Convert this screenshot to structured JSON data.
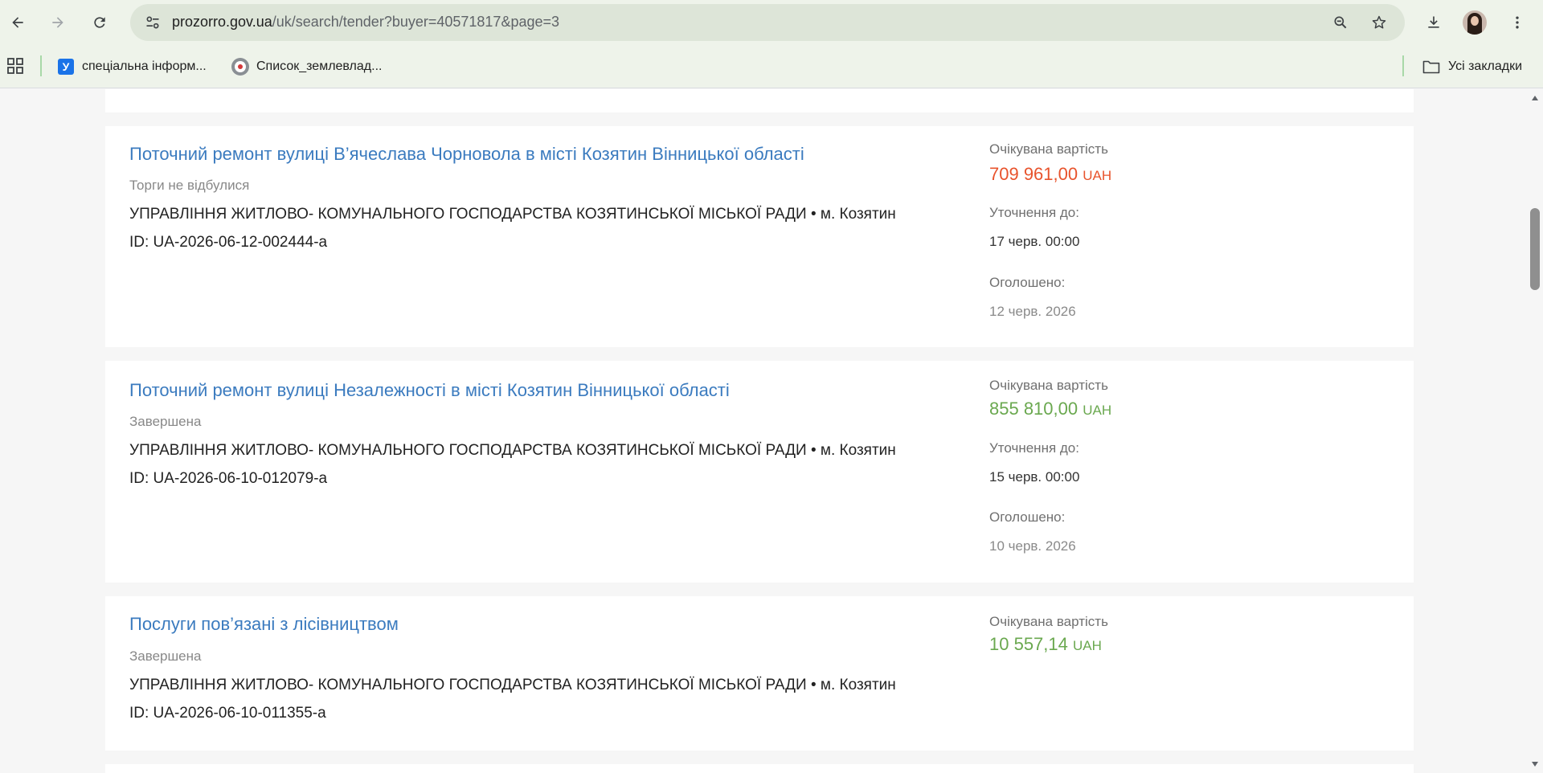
{
  "browser": {
    "url_host": "prozorro.gov.ua",
    "url_rest": "/uk/search/tender?buyer=40571817&page=3",
    "bookmarks": [
      {
        "label": "спеціальна інформ...",
        "favicon_letter": "У"
      },
      {
        "label": "Список_землевлад..."
      }
    ],
    "all_bookmarks_label": "Усі закладки"
  },
  "tenders": [
    {
      "title": "Поточний ремонт вулиці В’ячеслава Чорновола в місті Козятин Вінницької області",
      "status": "Торги не відбулися",
      "organization": "УПРАВЛІННЯ ЖИТЛОВО- КОМУНАЛЬНОГО ГОСПОДАРСТВА КОЗЯТИНСЬКОЇ МІСЬКОЇ РАДИ • м. Козятин",
      "id": "ID: UA-2026-06-12-002444-a",
      "expected_value_label": "Очікувана вартість",
      "amount": "709 961,00",
      "currency": "UAH",
      "amount_color": "#e8532c",
      "clarification_label": "Уточнення до:",
      "clarification_date": "17 черв. 00:00",
      "announced_label": "Оголошено:",
      "announced_date": "12 черв. 2026"
    },
    {
      "title": "Поточний ремонт вулиці Незалежності в місті Козятин Вінницької області",
      "status": "Завершена",
      "organization": "УПРАВЛІННЯ ЖИТЛОВО- КОМУНАЛЬНОГО ГОСПОДАРСТВА КОЗЯТИНСЬКОЇ МІСЬКОЇ РАДИ • м. Козятин",
      "id": "ID: UA-2026-06-10-012079-a",
      "expected_value_label": "Очікувана вартість",
      "amount": "855 810,00",
      "currency": "UAH",
      "amount_color": "#6aa84f",
      "clarification_label": "Уточнення до:",
      "clarification_date": "15 черв. 00:00",
      "announced_label": "Оголошено:",
      "announced_date": "10 черв. 2026"
    },
    {
      "title": "Послуги пов’язані з лісівництвом",
      "status": "Завершена",
      "organization": "УПРАВЛІННЯ ЖИТЛОВО- КОМУНАЛЬНОГО ГОСПОДАРСТВА КОЗЯТИНСЬКОЇ МІСЬКОЇ РАДИ • м. Козятин",
      "id": "ID: UA-2026-06-10-011355-a",
      "expected_value_label": "Очікувана вартість",
      "amount": "10 557,14",
      "currency": "UAH",
      "amount_color": "#6aa84f"
    }
  ],
  "colors": {
    "link_blue": "#3b7bbf",
    "amount_red": "#e8532c",
    "amount_green": "#6aa84f",
    "chrome_bg": "#eef3ea"
  }
}
